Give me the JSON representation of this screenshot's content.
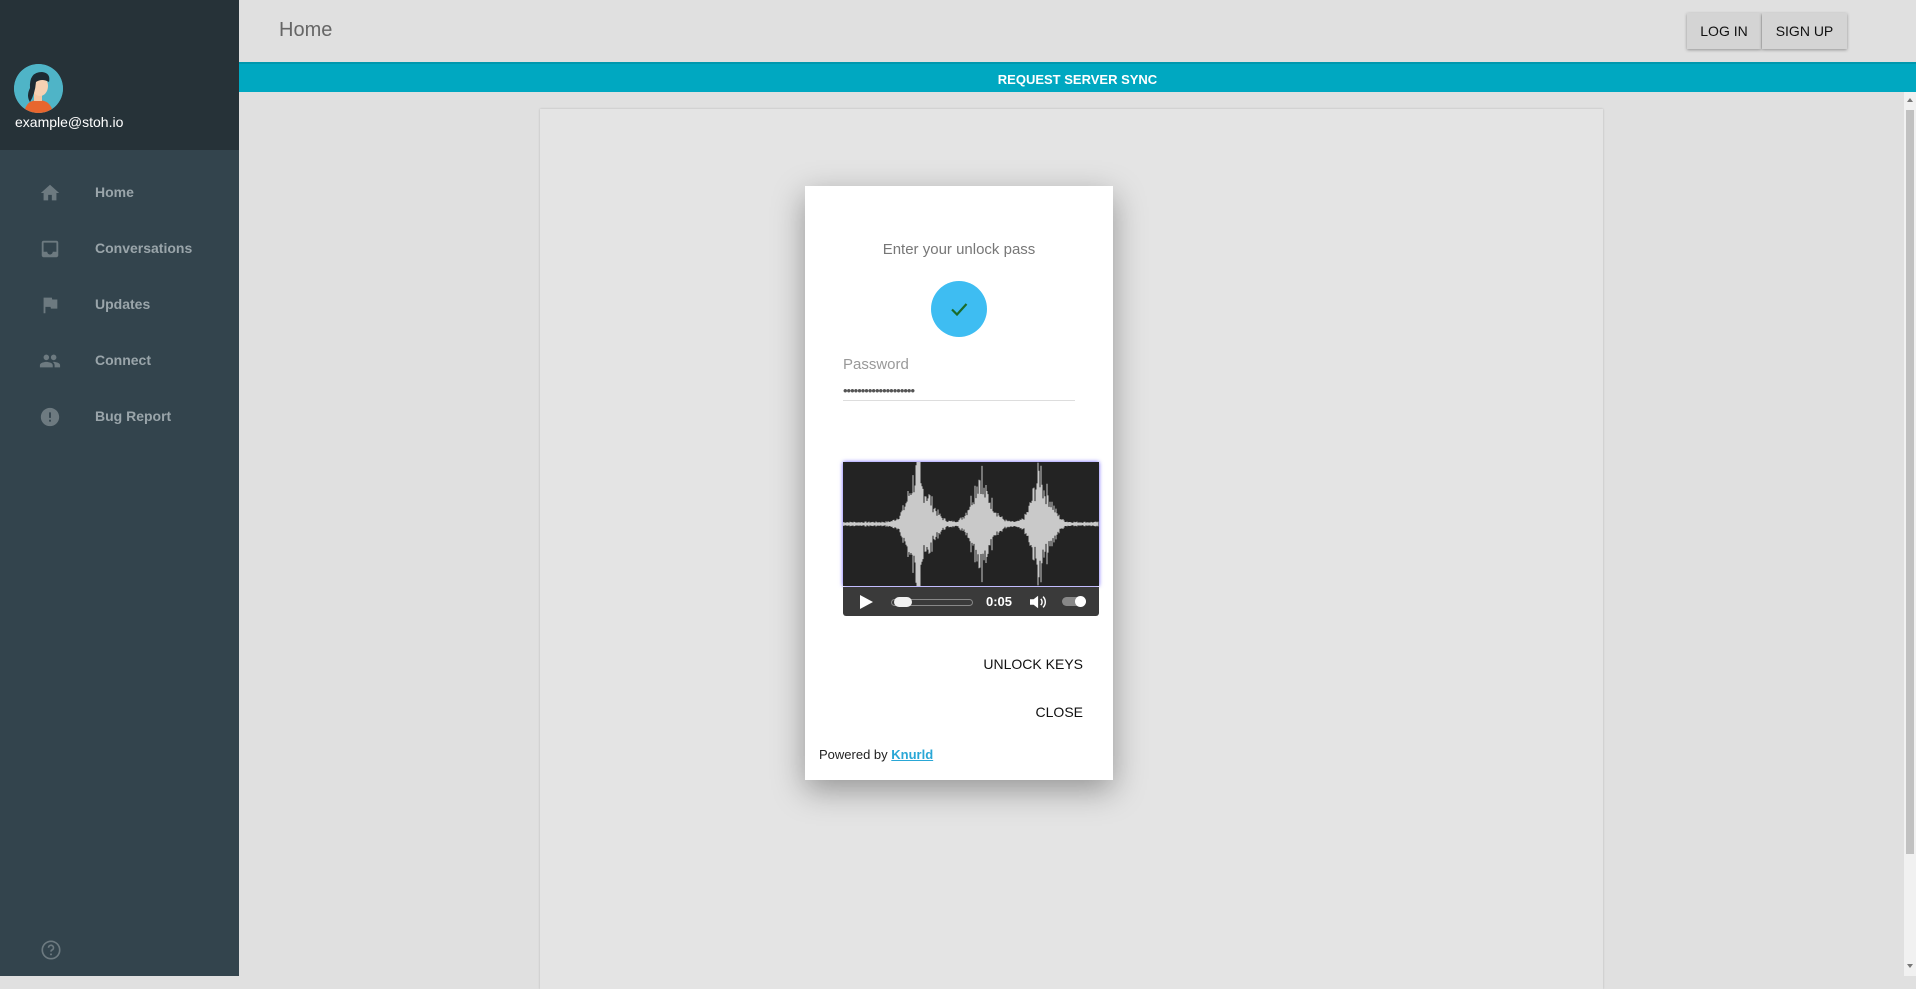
{
  "user": {
    "email": "example@stoh.io"
  },
  "sidebar": {
    "items": [
      {
        "label": "Home",
        "icon": "home-icon"
      },
      {
        "label": "Conversations",
        "icon": "inbox-icon"
      },
      {
        "label": "Updates",
        "icon": "flag-icon"
      },
      {
        "label": "Connect",
        "icon": "people-icon"
      },
      {
        "label": "Bug Report",
        "icon": "alert-icon"
      }
    ],
    "footer_icon": "help-icon"
  },
  "header": {
    "title": "Home",
    "login_label": "LOG IN",
    "signup_label": "SIGN UP"
  },
  "sync_bar": {
    "label": "REQUEST SERVER SYNC"
  },
  "dialog": {
    "title": "Enter your unlock pass",
    "password_label": "Password",
    "password_value": "••••••••••••••••••••",
    "audio": {
      "time": "0:05",
      "progress": 0.05,
      "volume": 1.0
    },
    "unlock_label": "UNLOCK KEYS",
    "close_label": "CLOSE",
    "powered_prefix": "Powered by",
    "powered_link": "Knurld"
  },
  "colors": {
    "sidebar_bg": "#33444d",
    "sidebar_top": "#263238",
    "accent": "#00a8c1",
    "check": "#3ebdf2"
  }
}
